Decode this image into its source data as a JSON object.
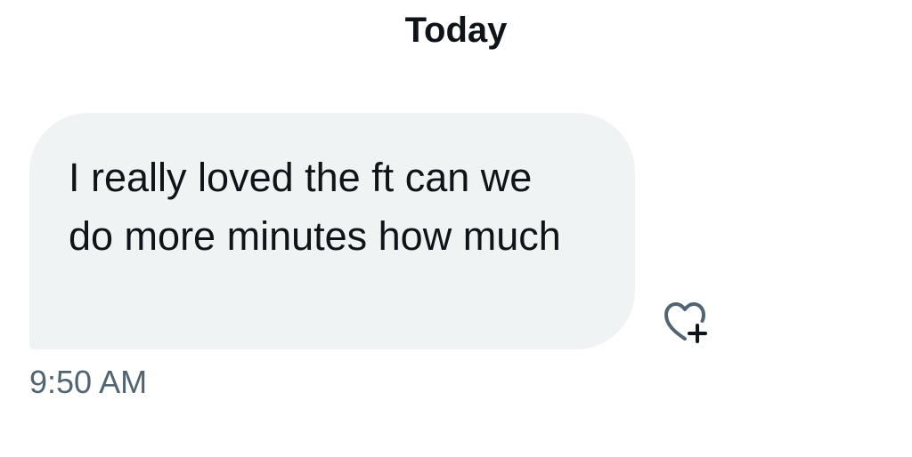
{
  "conversation": {
    "day_separator": "Today"
  },
  "message": {
    "text": "I really loved the ft can we do more minutes how much",
    "timestamp": "9:50 AM",
    "react_icon": "heart-plus-icon"
  },
  "colors": {
    "bubble_background": "#eff3f4",
    "text_primary": "#0f1419",
    "text_secondary": "#536471"
  }
}
